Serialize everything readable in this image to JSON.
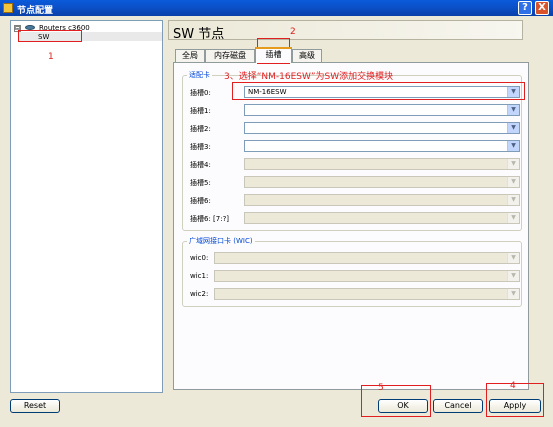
{
  "window": {
    "title": "节点配置",
    "help_glyph": "?",
    "close_glyph": "X"
  },
  "tree": {
    "expander": "⊟",
    "root_label": "Routers c3600",
    "child_label": "SW"
  },
  "header": {
    "title": "SW 节点"
  },
  "tabs": [
    {
      "label": "全局",
      "active": false
    },
    {
      "label": "内存磁盘",
      "active": false
    },
    {
      "label": "插槽",
      "active": true
    },
    {
      "label": "高级",
      "active": false
    }
  ],
  "adapters": {
    "group_label": "适配卡",
    "slots": [
      {
        "label": "插槽0:",
        "value": "NM-16ESW",
        "enabled": true
      },
      {
        "label": "插槽1:",
        "value": "",
        "enabled": true
      },
      {
        "label": "插槽2:",
        "value": "",
        "enabled": true
      },
      {
        "label": "插槽3:",
        "value": "",
        "enabled": true
      },
      {
        "label": "插槽4:",
        "value": "",
        "enabled": false
      },
      {
        "label": "插槽5:",
        "value": "",
        "enabled": false
      },
      {
        "label": "插槽6:",
        "value": "",
        "enabled": false
      },
      {
        "label": "插槽6: [7:?]",
        "value": "",
        "enabled": false
      }
    ]
  },
  "wics": {
    "group_label": "广域网接口卡 (WIC)",
    "slots": [
      {
        "label": "wic0:",
        "value": ""
      },
      {
        "label": "wic1:",
        "value": ""
      },
      {
        "label": "wic2:",
        "value": ""
      }
    ]
  },
  "buttons": {
    "reset": "Reset",
    "ok": "OK",
    "cancel": "Cancel",
    "apply": "Apply"
  },
  "annotations": {
    "n1": "1",
    "n2": "2",
    "step3": "3、选择“NM-16ESW”为SW添加交换模块",
    "n4": "4",
    "n5": "5"
  },
  "colors": {
    "annotation": "#e02020",
    "titlebar": "#0A4FC6",
    "group_label": "#0046d5"
  }
}
